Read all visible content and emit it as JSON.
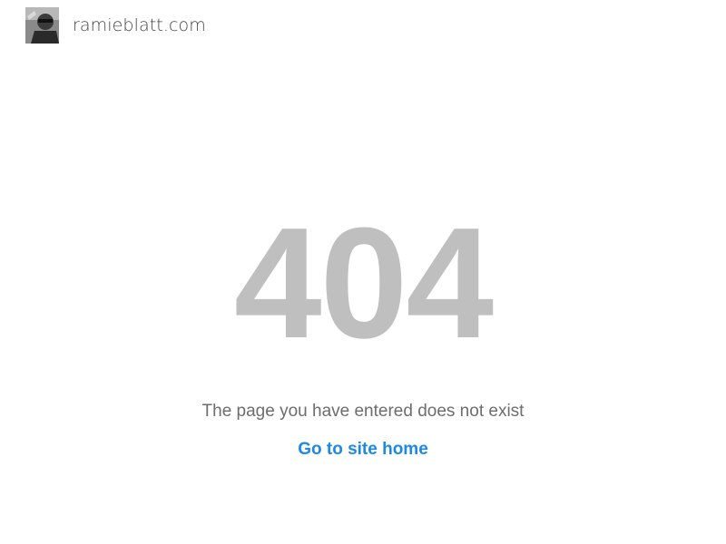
{
  "header": {
    "site_name": "ramieblatt.com",
    "avatar_icon": "avatar-photo"
  },
  "error": {
    "code": "404",
    "message": "The page you have entered does not exist",
    "home_link_label": "Go to site home"
  },
  "colors": {
    "error_code": "#bfbfbf",
    "message": "#6d6d6d",
    "link": "#1e88e5",
    "background": "#ffffff"
  }
}
